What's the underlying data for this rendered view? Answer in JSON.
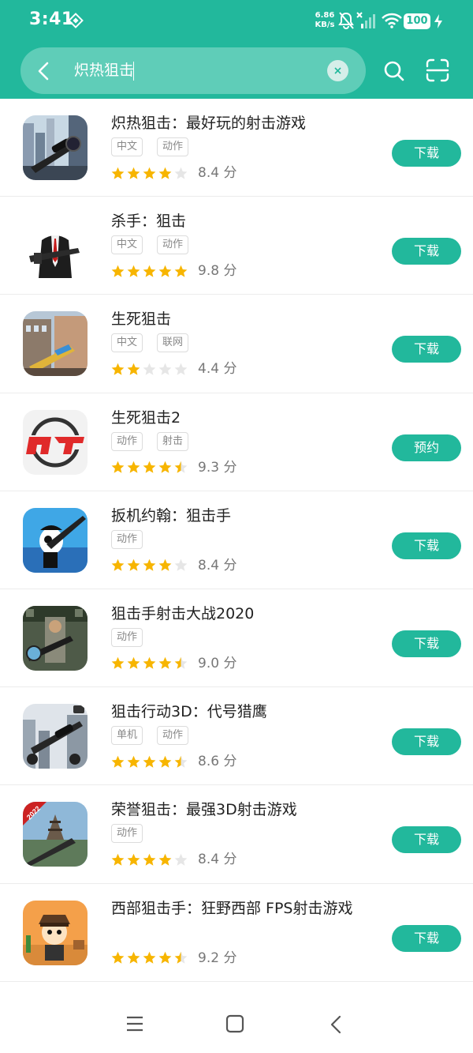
{
  "status_bar": {
    "time": "3:41",
    "speed_value": "6.86",
    "speed_unit": "KB/s",
    "battery": "100"
  },
  "search": {
    "query": "炽热狙击",
    "icons": [
      "back-icon",
      "clear-icon",
      "search-icon",
      "scan-icon"
    ]
  },
  "apps": [
    {
      "name": "炽热狙击：最好玩的射击游戏",
      "tags": [
        "中文",
        "动作"
      ],
      "stars": 4,
      "score": "8.4 分",
      "button": "下载"
    },
    {
      "name": "杀手：狙击",
      "tags": [
        "中文",
        "动作"
      ],
      "stars": 5,
      "score": "9.8 分",
      "button": "下载"
    },
    {
      "name": "生死狙击",
      "tags": [
        "中文",
        "联网"
      ],
      "stars": 2,
      "score": "4.4 分",
      "button": "下载"
    },
    {
      "name": "生死狙击2",
      "tags": [
        "动作",
        "射击"
      ],
      "stars": 4.5,
      "score": "9.3 分",
      "button": "预约"
    },
    {
      "name": "扳机约翰：狙击手",
      "tags": [
        "动作"
      ],
      "stars": 4,
      "score": "8.4 分",
      "button": "下载"
    },
    {
      "name": "狙击手射击大战2020",
      "tags": [
        "动作"
      ],
      "stars": 4.5,
      "score": "9.0 分",
      "button": "下载"
    },
    {
      "name": "狙击行动3D：代号猎鹰",
      "tags": [
        "单机",
        "动作"
      ],
      "stars": 4.5,
      "score": "8.6 分",
      "button": "下载"
    },
    {
      "name": "荣誉狙击：最强3D射击游戏",
      "tags": [
        "动作"
      ],
      "stars": 4,
      "score": "8.4 分",
      "button": "下载"
    },
    {
      "name": "西部狙击手：狂野西部 FPS射击游戏",
      "tags": [],
      "stars": 4.5,
      "score": "9.2 分",
      "button": "下载"
    }
  ],
  "icon_badge_2022": "2022",
  "colors": {
    "accent": "#22b89c",
    "star_on": "#f7b500",
    "star_off": "#e6e6e6"
  },
  "nav": [
    "menu-icon",
    "home-icon",
    "back-icon"
  ]
}
